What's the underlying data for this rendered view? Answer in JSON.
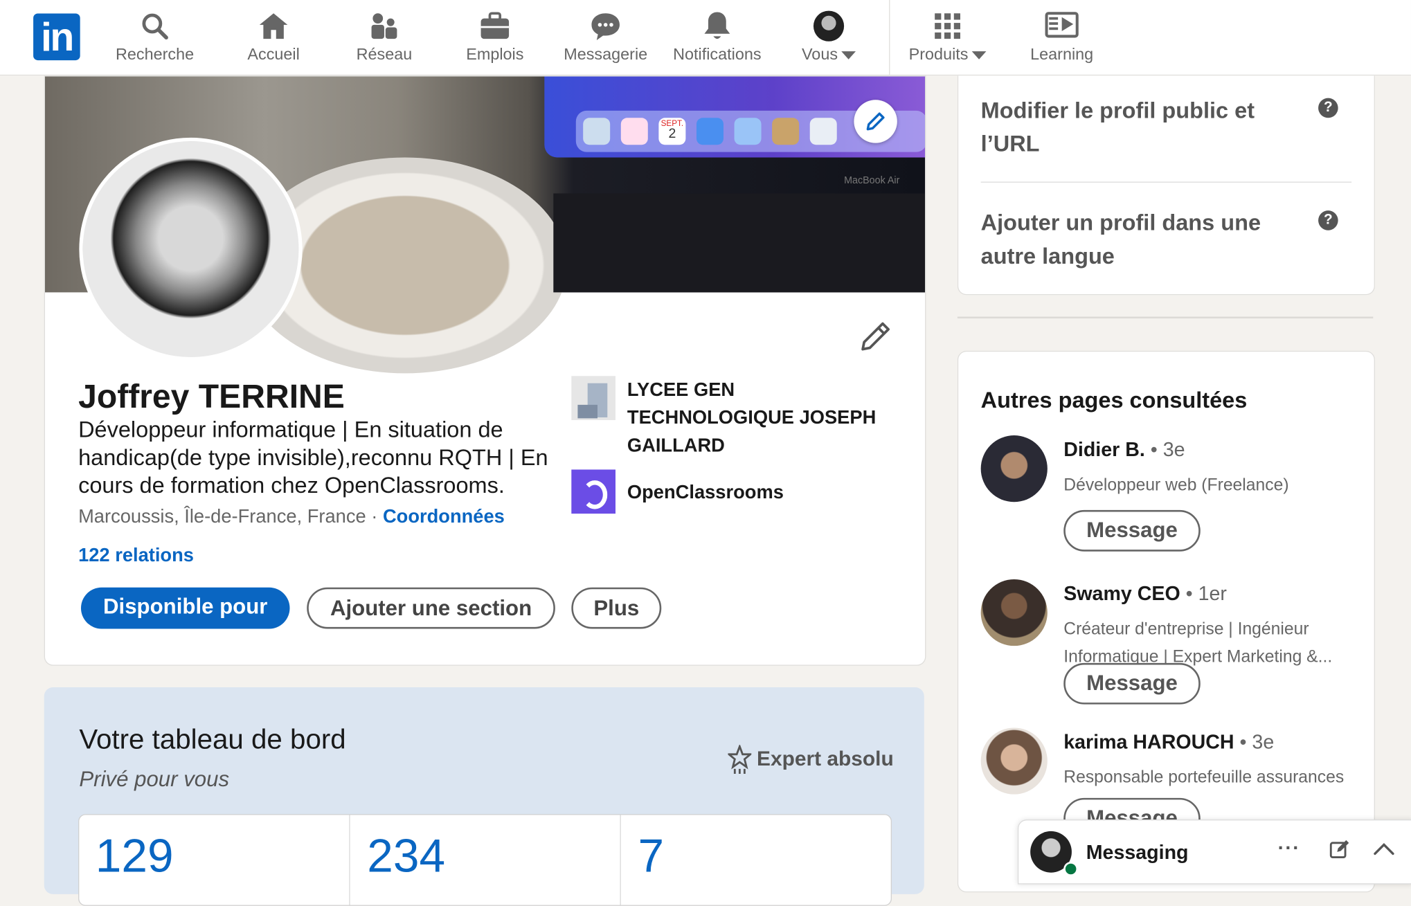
{
  "nav": {
    "logo": "in",
    "items": [
      {
        "label": "Recherche",
        "icon": "search-icon"
      },
      {
        "label": "Accueil",
        "icon": "home-icon"
      },
      {
        "label": "Réseau",
        "icon": "network-icon"
      },
      {
        "label": "Emplois",
        "icon": "briefcase-icon"
      },
      {
        "label": "Messagerie",
        "icon": "chat-icon"
      },
      {
        "label": "Notifications",
        "icon": "bell-icon"
      },
      {
        "label": "Vous",
        "icon": "avatar"
      },
      {
        "label": "Produits",
        "icon": "grid-icon"
      },
      {
        "label": "Learning",
        "icon": "learning-icon"
      }
    ]
  },
  "banner": {
    "laptop_label": "MacBook Air",
    "dock_calendar_month": "SEPT.",
    "dock_calendar_day": "2"
  },
  "profile": {
    "name": "Joffrey TERRINE",
    "headline": "Développeur informatique | En situation de handicap(de type invisible),reconnu RQTH | En cours de formation chez OpenClassrooms.",
    "location": "Marcoussis, Île-de-France, France · ",
    "contact_link": "Coordonnées",
    "relations": "122 relations",
    "buttons": {
      "available": "Disponible pour",
      "add_section": "Ajouter une section",
      "more": "Plus"
    },
    "education": [
      {
        "name": "LYCEE GEN TECHNOLOGIQUE JOSEPH GAILLARD"
      },
      {
        "name": "OpenClassrooms"
      }
    ]
  },
  "dashboard": {
    "title": "Votre tableau de bord",
    "subtitle": "Privé pour vous",
    "badge": "Expert absolu",
    "stats": [
      "129",
      "234",
      "7"
    ]
  },
  "right_top": {
    "links": [
      "Modifier le profil public et l’URL",
      "Ajouter un profil dans une autre langue"
    ],
    "help": "?"
  },
  "people": {
    "title": "Autres pages consultées",
    "message_label": "Message",
    "list": [
      {
        "name": "Didier B.",
        "degree": " • 3e",
        "desc": "Développeur web (Freelance)"
      },
      {
        "name": "Swamy CEO",
        "degree": " • 1er",
        "desc": "Créateur d'entreprise | Ingénieur Informatique | Expert Marketing &..."
      },
      {
        "name": "karima HAROUCH",
        "degree": " • 3e",
        "desc": "Responsable portefeuille assurances"
      }
    ]
  },
  "messaging": {
    "title": "Messaging",
    "more": "···"
  },
  "colors": {
    "brand": "#0a66c2",
    "background": "#f4f2ee",
    "dashboard_bg": "#dbe5f1"
  }
}
